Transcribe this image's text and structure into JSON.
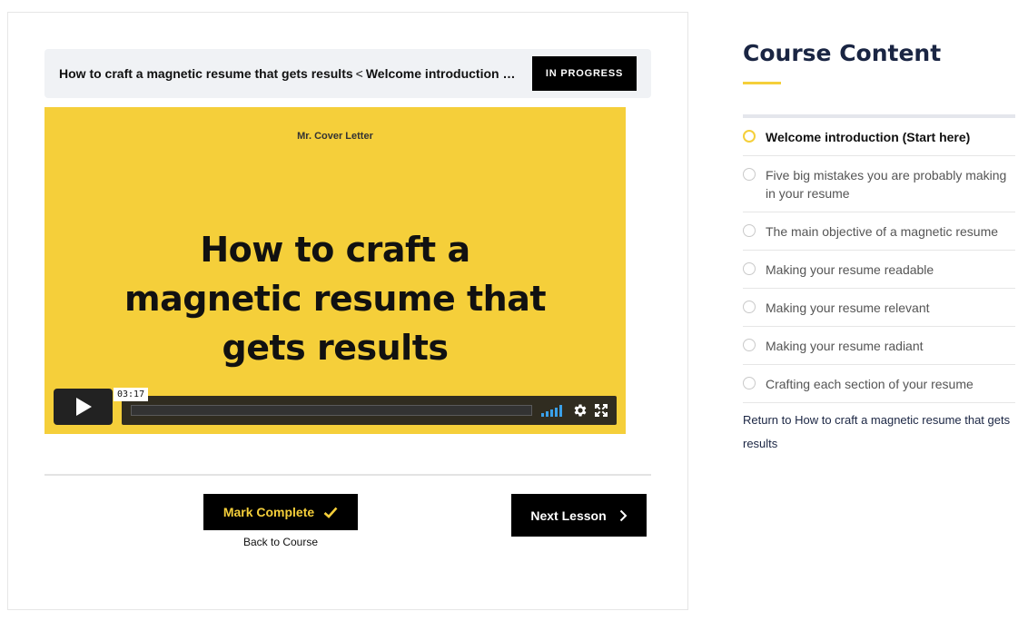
{
  "header": {
    "breadcrumb_course": "How to craft a magnetic resume that gets results",
    "breadcrumb_separator": "<",
    "breadcrumb_lesson": "Welcome introduction (Start here)",
    "status": "IN PROGRESS"
  },
  "video": {
    "brand": "Mr. Cover Letter",
    "title": "How to craft a magnetic resume that gets results",
    "time": "03:17",
    "play_icon": "play-icon",
    "volume_icon": "volume-icon",
    "settings_icon": "gear-icon",
    "fullscreen_icon": "fullscreen-icon"
  },
  "actions": {
    "mark_complete": "Mark Complete",
    "back_to_course": "Back to Course",
    "next_lesson": "Next Lesson"
  },
  "sidebar": {
    "title": "Course Content",
    "lessons": [
      {
        "label": "Welcome introduction (Start here)",
        "active": true
      },
      {
        "label": "Five big mistakes you are probably making in your resume",
        "active": false
      },
      {
        "label": "The main objective of a magnetic resume",
        "active": false
      },
      {
        "label": "Making your resume readable",
        "active": false
      },
      {
        "label": "Making your resume relevant",
        "active": false
      },
      {
        "label": "Making your resume radiant",
        "active": false
      },
      {
        "label": "Crafting each section of your resume",
        "active": false
      }
    ],
    "return_prefix": "Return to",
    "return_course": "How to craft a magnetic resume that gets results"
  },
  "colors": {
    "accent": "#f5cf3a",
    "navy": "#1a2543",
    "volume": "#3aa0e8"
  }
}
